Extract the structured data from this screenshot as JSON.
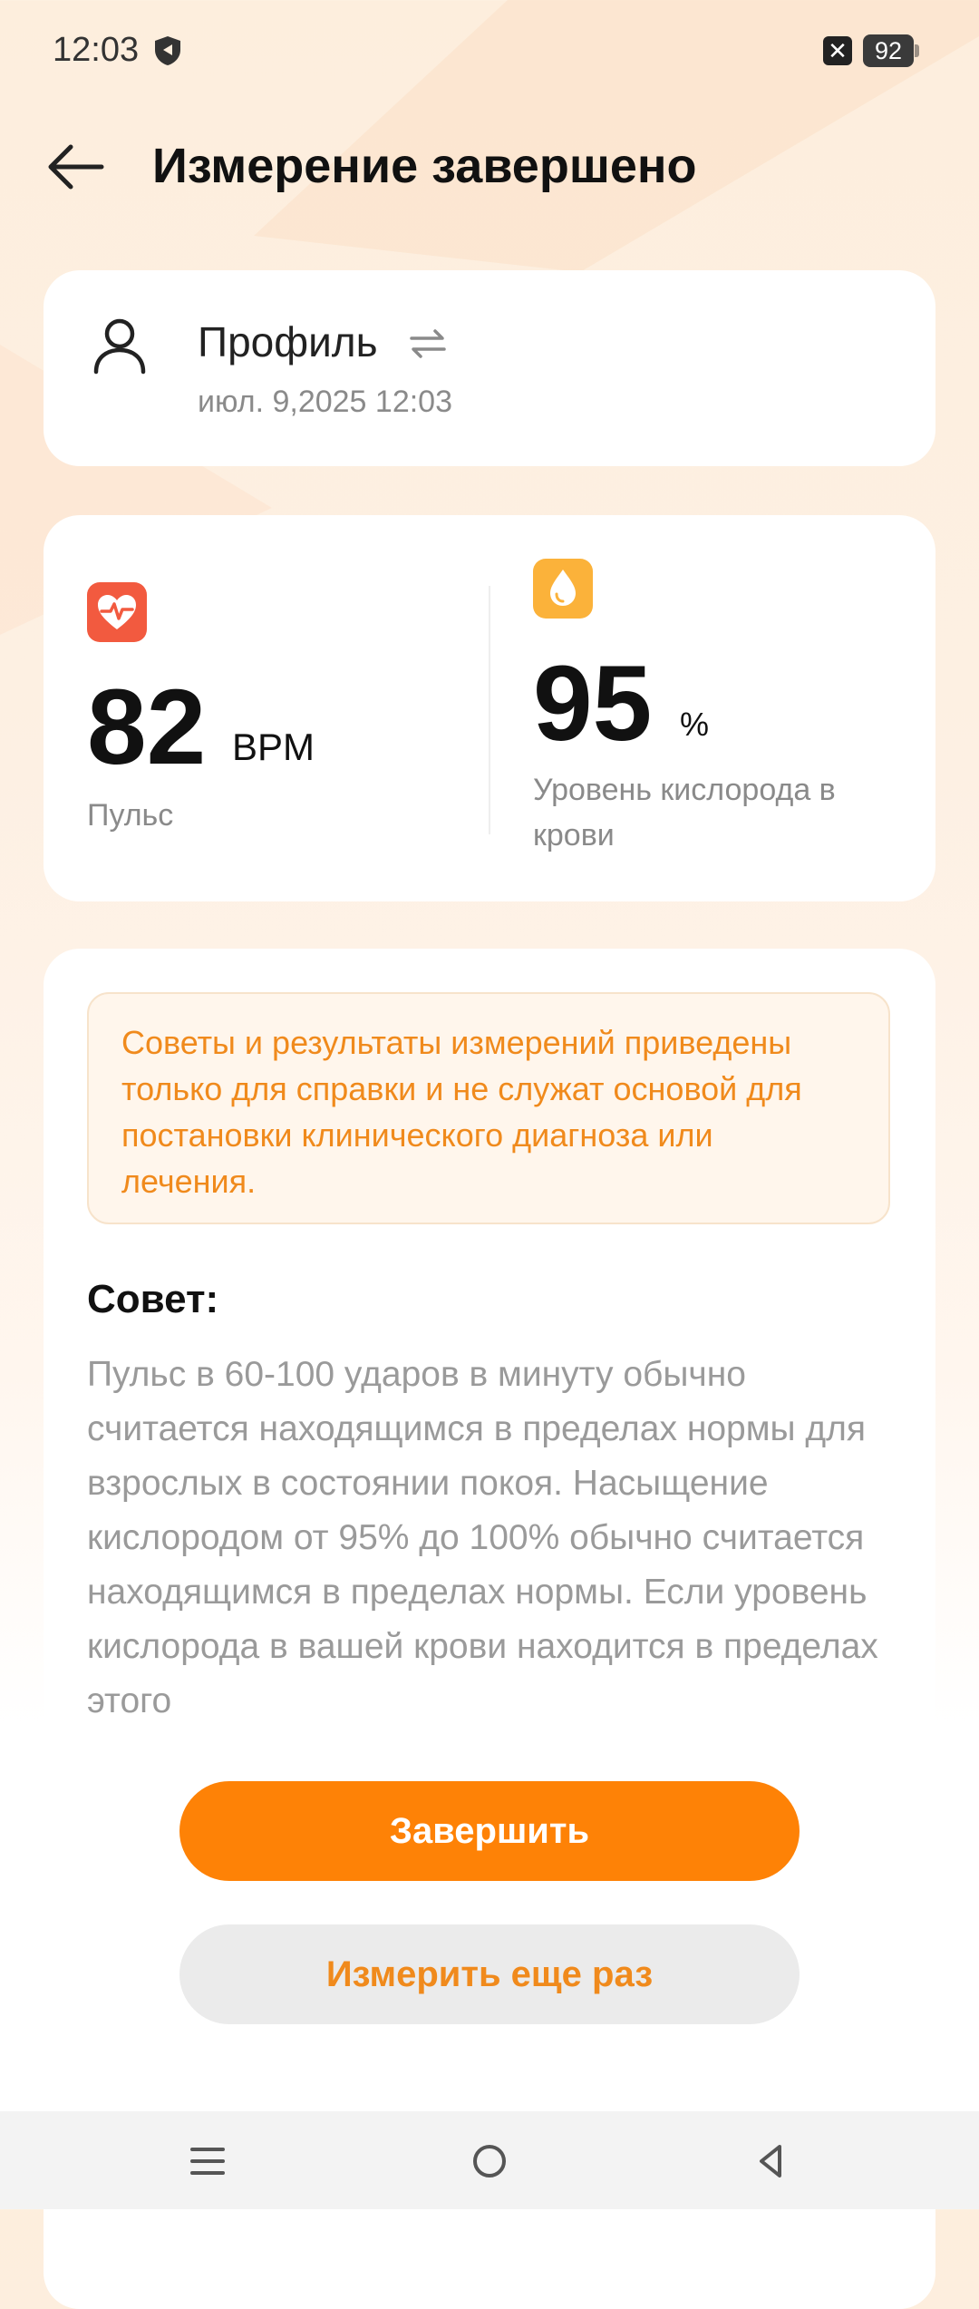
{
  "status_bar": {
    "time": "12:03",
    "battery": "92",
    "sim_symbol": "✕"
  },
  "header": {
    "title": "Измерение завершено"
  },
  "profile": {
    "name": "Профиль",
    "datetime": "июл. 9,2025 12:03"
  },
  "metrics": {
    "pulse": {
      "value": "82",
      "unit": "BPM",
      "label": "Пульс"
    },
    "oxygen": {
      "value": "95",
      "unit": "%",
      "label": "Уровень кислорода в крови"
    }
  },
  "disclaimer": "Советы и результаты измерений приведены только для справки и не служат основой для постановки клинического диагноза или лечения.",
  "advice": {
    "heading": "Совет:",
    "body": "Пульс в 60-100 ударов в минуту обычно считается находящимся в пределах нормы для взрослых в состоянии покоя. Насыщение кислородом от 95% до 100% обычно считается находящимся в пределах нормы. Если уровень кислорода в вашей крови находится в пределах этого"
  },
  "buttons": {
    "finish": "Завершить",
    "repeat": "Измерить еще раз"
  },
  "colors": {
    "accent": "#fe8206",
    "heart": "#f25a3f",
    "drop": "#fbb23a",
    "warning_text": "#f08a1c"
  },
  "icons": {
    "back": "arrow-left-icon",
    "person": "person-icon",
    "swap": "swap-icon",
    "heart": "heart-pulse-icon",
    "drop": "water-drop-icon"
  }
}
